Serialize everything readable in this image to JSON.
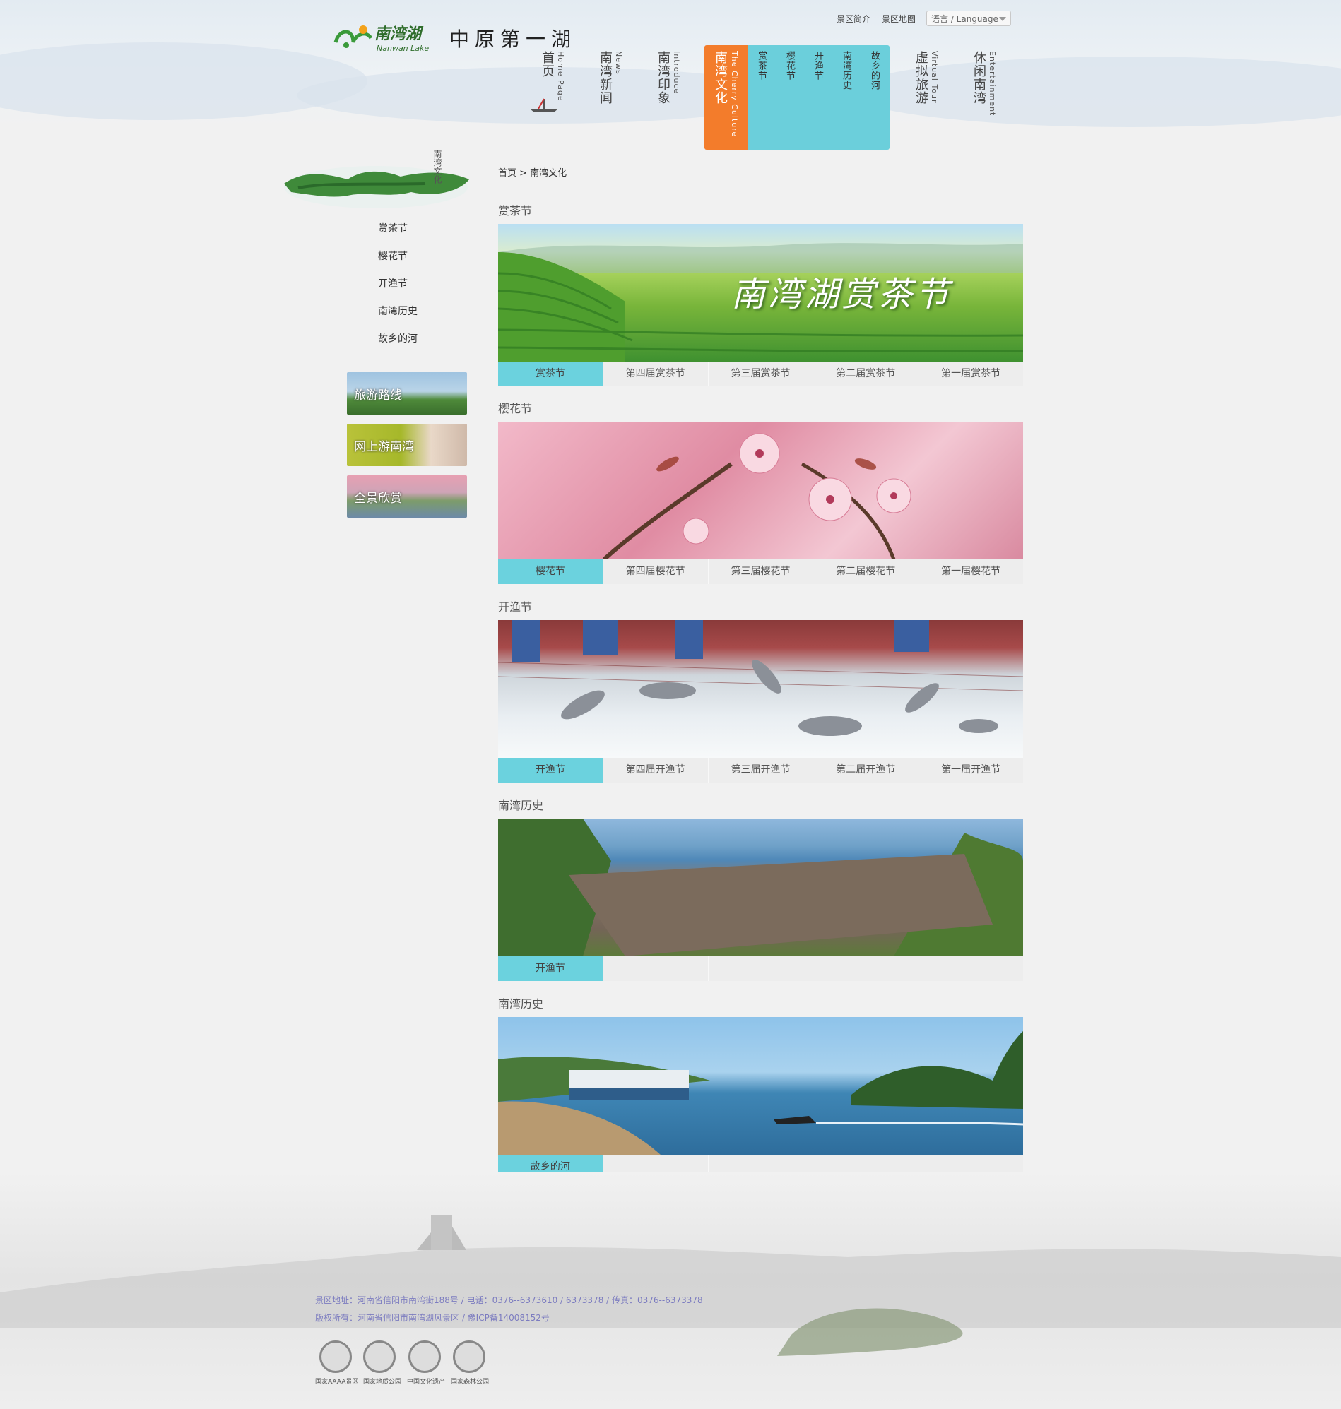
{
  "header": {
    "logo_text": "南湾湖",
    "logo_sub": "Nanwan Lake",
    "slogan": "中原第一湖",
    "top_links": [
      "景区简介",
      "景区地图"
    ],
    "language_label": "语言 / Language"
  },
  "nav": {
    "items": [
      {
        "cn": "首页",
        "en": "Home Page"
      },
      {
        "cn": "南湾新闻",
        "en": "News"
      },
      {
        "cn": "南湾印象",
        "en": "Introduce"
      },
      {
        "cn": "南湾文化",
        "en": "The Cherry Culture"
      },
      {
        "cn": "虚拟旅游",
        "en": "Virtual Tour"
      },
      {
        "cn": "休闲南湾",
        "en": "Entertainment"
      }
    ],
    "submenu": [
      "赏茶节",
      "樱花节",
      "开渔节",
      "南湾历史",
      "故乡的河"
    ]
  },
  "sidebar": {
    "image_caption": "南湾文化",
    "links": [
      "赏茶节",
      "樱花节",
      "开渔节",
      "南湾历史",
      "故乡的河"
    ],
    "promos": [
      "旅游路线",
      "网上游南湾",
      "全景欣赏"
    ]
  },
  "breadcrumb": "首页 > 南湾文化",
  "sections": [
    {
      "title": "赏茶节",
      "banner_text": "南湾湖赏茶节",
      "tabs": [
        "赏茶节",
        "第四届赏茶节",
        "第三届赏茶节",
        "第二届赏茶节",
        "第一届赏茶节"
      ]
    },
    {
      "title": "樱花节",
      "tabs": [
        "樱花节",
        "第四届樱花节",
        "第三届樱花节",
        "第二届樱花节",
        "第一届樱花节"
      ]
    },
    {
      "title": "开渔节",
      "tabs": [
        "开渔节",
        "第四届开渔节",
        "第三届开渔节",
        "第二届开渔节",
        "第一届开渔节"
      ]
    },
    {
      "title": "南湾历史",
      "tabs": [
        "开渔节",
        "",
        "",
        "",
        ""
      ]
    },
    {
      "title": "南湾历史",
      "tabs": [
        "故乡的河",
        "",
        "",
        "",
        ""
      ]
    }
  ],
  "footer": {
    "line1": "景区地址：河南省信阳市南湾街188号 / 电话：0376--6373610 / 6373378 / 传真：0376--6373378",
    "line2": "版权所有：河南省信阳市南湾湖风景区 / 豫ICP备14008152号",
    "badges": [
      "国家AAAA景区",
      "国家地质公园",
      "中国文化遗产",
      "国家森林公园"
    ]
  },
  "colors": {
    "accent_orange": "#f37c2b",
    "accent_cyan": "#6bcfdb",
    "footer_text": "#7c7cc0"
  }
}
